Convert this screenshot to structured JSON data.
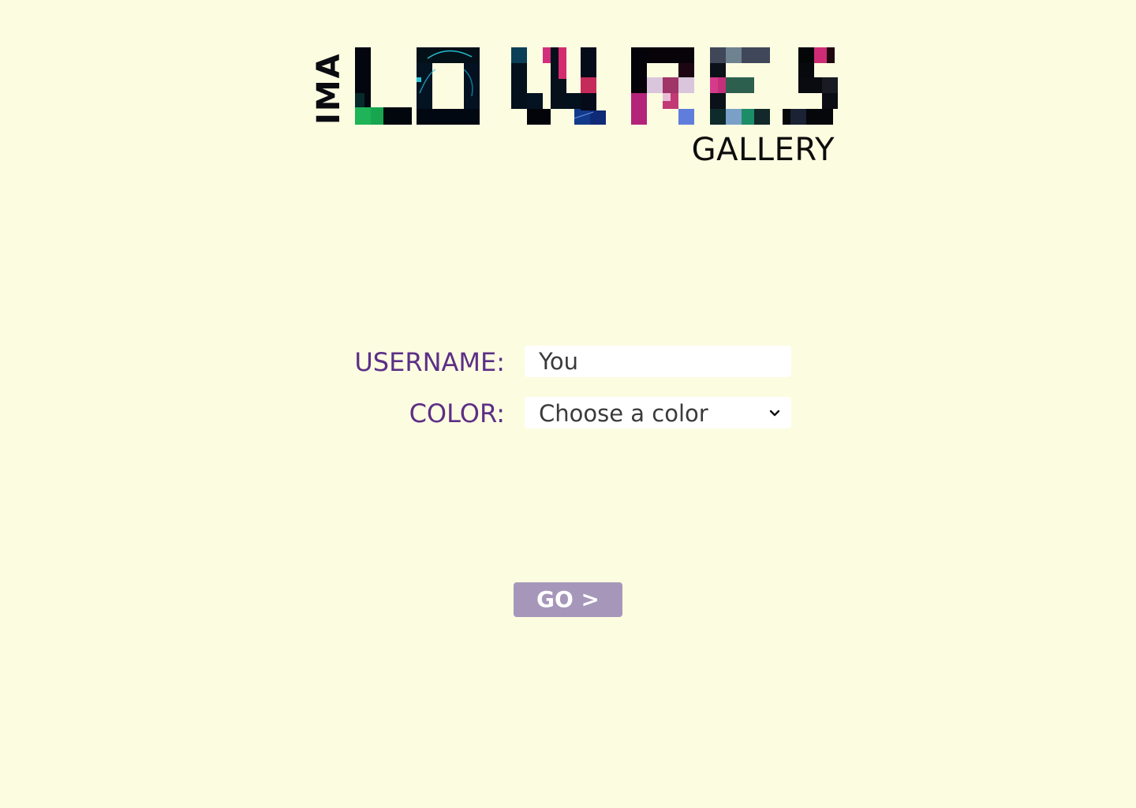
{
  "logo": {
    "prefix": "IMA",
    "wordmark": "LOWRES",
    "subtitle": "GALLERY"
  },
  "form": {
    "username": {
      "label": "USERNAME:",
      "value": "You"
    },
    "color": {
      "label": "COLOR:",
      "selected": "Choose a color"
    }
  },
  "actions": {
    "go_label": "GO >"
  },
  "colors": {
    "background": "#fcfce1",
    "label": "#5c2f86",
    "button": "#a697ba"
  }
}
